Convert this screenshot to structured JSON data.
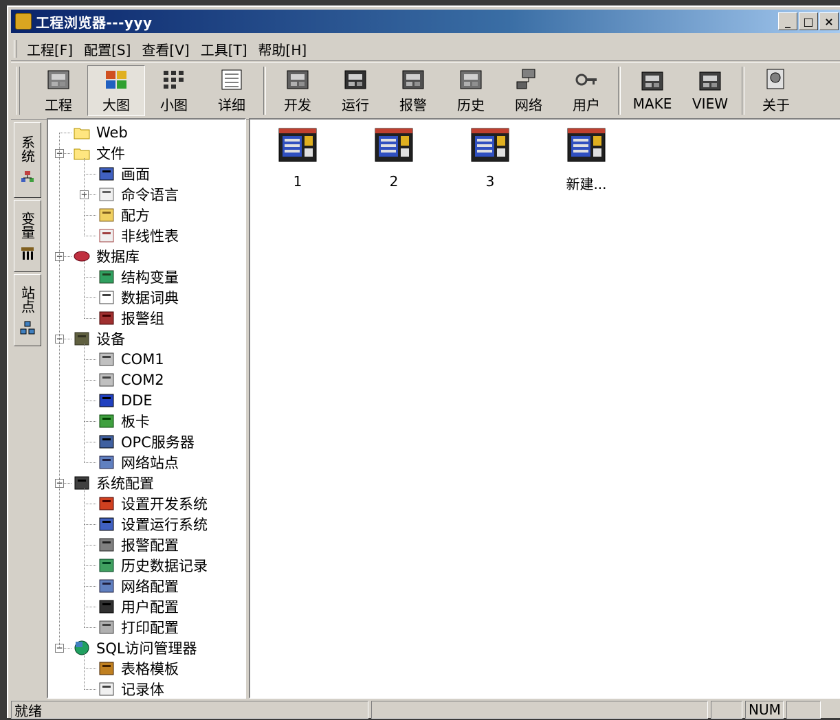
{
  "window": {
    "title": "工程浏览器---yyy",
    "buttons": [
      "_",
      "□",
      "×"
    ]
  },
  "menu": [
    "工程[F]",
    "配置[S]",
    "查看[V]",
    "工具[T]",
    "帮助[H]"
  ],
  "toolbar": [
    {
      "label": "工程",
      "icon": "project-icon"
    },
    {
      "label": "大图",
      "icon": "large-icons-icon",
      "pressed": true
    },
    {
      "label": "小图",
      "icon": "small-icons-icon"
    },
    {
      "label": "详细",
      "icon": "details-icon"
    },
    {
      "label": "开发",
      "icon": "develop-icon"
    },
    {
      "label": "运行",
      "icon": "run-icon"
    },
    {
      "label": "报警",
      "icon": "alarm-icon"
    },
    {
      "label": "历史",
      "icon": "history-icon"
    },
    {
      "label": "网络",
      "icon": "network-icon"
    },
    {
      "label": "用户",
      "icon": "user-icon"
    },
    {
      "label": "MAKE",
      "icon": "make-icon"
    },
    {
      "label": "VIEW",
      "icon": "view-icon"
    },
    {
      "label": "关于",
      "icon": "about-icon"
    }
  ],
  "side_tabs": [
    {
      "label": "系统",
      "icon": "system-tab-icon"
    },
    {
      "label": "变量",
      "icon": "variable-tab-icon"
    },
    {
      "label": "站点",
      "icon": "station-tab-icon"
    }
  ],
  "tree": [
    {
      "label": "Web",
      "icon": "folder-icon",
      "level": 1
    },
    {
      "label": "文件",
      "icon": "folder-open-icon",
      "level": 1,
      "expanded": true
    },
    {
      "label": "画面",
      "icon": "screen-icon",
      "level": 2
    },
    {
      "label": "命令语言",
      "icon": "command-icon",
      "level": 2,
      "collapsed": true
    },
    {
      "label": "配方",
      "icon": "recipe-icon",
      "level": 2
    },
    {
      "label": "非线性表",
      "icon": "nonlinear-table-icon",
      "level": 2
    },
    {
      "label": "数据库",
      "icon": "database-icon",
      "level": 1,
      "expanded": true
    },
    {
      "label": "结构变量",
      "icon": "struct-var-icon",
      "level": 2
    },
    {
      "label": "数据词典",
      "icon": "dictionary-icon",
      "level": 2
    },
    {
      "label": "报警组",
      "icon": "alarm-group-icon",
      "level": 2
    },
    {
      "label": "设备",
      "icon": "device-icon",
      "level": 1,
      "expanded": true
    },
    {
      "label": "COM1",
      "icon": "com-port-icon",
      "level": 2
    },
    {
      "label": "COM2",
      "icon": "com-port-icon",
      "level": 2
    },
    {
      "label": "DDE",
      "icon": "dde-icon",
      "level": 2
    },
    {
      "label": "板卡",
      "icon": "board-icon",
      "level": 2
    },
    {
      "label": "OPC服务器",
      "icon": "opc-icon",
      "level": 2
    },
    {
      "label": "网络站点",
      "icon": "network-site-icon",
      "level": 2
    },
    {
      "label": "系统配置",
      "icon": "tools-icon",
      "level": 1,
      "expanded": true
    },
    {
      "label": "设置开发系统",
      "icon": "dev-settings-icon",
      "level": 2
    },
    {
      "label": "设置运行系统",
      "icon": "run-settings-icon",
      "level": 2
    },
    {
      "label": "报警配置",
      "icon": "alarm-config-icon",
      "level": 2
    },
    {
      "label": "历史数据记录",
      "icon": "history-record-icon",
      "level": 2
    },
    {
      "label": "网络配置",
      "icon": "network-config-icon",
      "level": 2
    },
    {
      "label": "用户配置",
      "icon": "user-config-icon",
      "level": 2
    },
    {
      "label": "打印配置",
      "icon": "print-config-icon",
      "level": 2
    },
    {
      "label": "SQL访问管理器",
      "icon": "sql-icon",
      "level": 1,
      "expanded": true
    },
    {
      "label": "表格模板",
      "icon": "table-template-icon",
      "level": 2
    },
    {
      "label": "记录体",
      "icon": "record-icon",
      "level": 2
    }
  ],
  "items": [
    {
      "label": "1"
    },
    {
      "label": "2"
    },
    {
      "label": "3"
    },
    {
      "label": "新建..."
    }
  ],
  "status": {
    "text": "就绪",
    "num": "NUM"
  }
}
